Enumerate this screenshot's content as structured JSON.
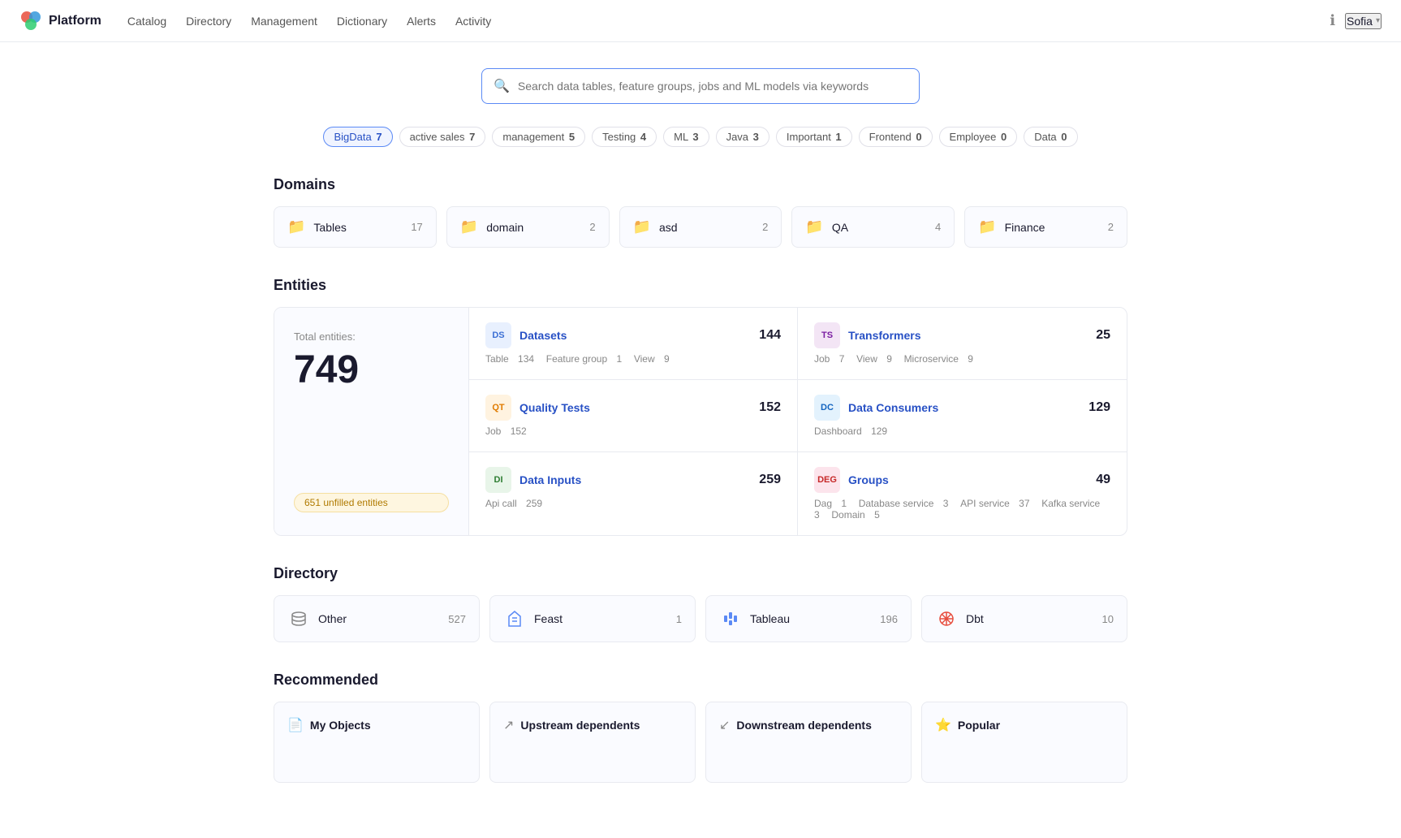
{
  "header": {
    "logo_text": "Platform",
    "nav": [
      {
        "label": "Catalog",
        "id": "catalog"
      },
      {
        "label": "Directory",
        "id": "directory"
      },
      {
        "label": "Management",
        "id": "management"
      },
      {
        "label": "Dictionary",
        "id": "dictionary"
      },
      {
        "label": "Alerts",
        "id": "alerts"
      },
      {
        "label": "Activity",
        "id": "activity"
      }
    ],
    "user": "Sofia"
  },
  "search": {
    "placeholder": "Search data tables, feature groups, jobs and ML models via keywords"
  },
  "tags": [
    {
      "label": "BigData",
      "count": "7",
      "active": true
    },
    {
      "label": "active sales",
      "count": "7",
      "active": false
    },
    {
      "label": "management",
      "count": "5",
      "active": false
    },
    {
      "label": "Testing",
      "count": "4",
      "active": false
    },
    {
      "label": "ML",
      "count": "3",
      "active": false
    },
    {
      "label": "Java",
      "count": "3",
      "active": false
    },
    {
      "label": "Important",
      "count": "1",
      "active": false
    },
    {
      "label": "Frontend",
      "count": "0",
      "active": false
    },
    {
      "label": "Employee",
      "count": "0",
      "active": false
    },
    {
      "label": "Data",
      "count": "0",
      "active": false
    }
  ],
  "domains": {
    "title": "Domains",
    "items": [
      {
        "name": "Tables",
        "count": "17"
      },
      {
        "name": "domain",
        "count": "2"
      },
      {
        "name": "asd",
        "count": "2"
      },
      {
        "name": "QA",
        "count": "4"
      },
      {
        "name": "Finance",
        "count": "2"
      }
    ]
  },
  "entities": {
    "title": "Entities",
    "total_label": "Total entities:",
    "total": "749",
    "unfilled": "651 unfilled entities",
    "items": [
      {
        "badge": "DS",
        "badge_class": "badge-ds",
        "name": "Datasets",
        "count": "144",
        "meta": [
          {
            "key": "Table",
            "val": "134"
          },
          {
            "key": "Feature group",
            "val": "1"
          },
          {
            "key": "View",
            "val": "9"
          }
        ]
      },
      {
        "badge": "TS",
        "badge_class": "badge-ts",
        "name": "Transformers",
        "count": "25",
        "meta": [
          {
            "key": "Job",
            "val": "7"
          },
          {
            "key": "View",
            "val": "9"
          },
          {
            "key": "Microservice",
            "val": "9"
          }
        ]
      },
      {
        "badge": "QT",
        "badge_class": "badge-qt",
        "name": "Quality Tests",
        "count": "152",
        "meta": [
          {
            "key": "Job",
            "val": "152"
          }
        ]
      },
      {
        "badge": "DC",
        "badge_class": "badge-dc",
        "name": "Data Consumers",
        "count": "129",
        "meta": [
          {
            "key": "Dashboard",
            "val": "129"
          }
        ]
      },
      {
        "badge": "DI",
        "badge_class": "badge-di",
        "name": "Data Inputs",
        "count": "259",
        "meta": [
          {
            "key": "Api call",
            "val": "259"
          }
        ]
      },
      {
        "badge": "DEG",
        "badge_class": "badge-deg",
        "name": "Groups",
        "count": "49",
        "meta": [
          {
            "key": "Dag",
            "val": "1"
          },
          {
            "key": "Database service",
            "val": "3"
          },
          {
            "key": "API service",
            "val": "37"
          },
          {
            "key": "Kafka service",
            "val": "3"
          },
          {
            "key": "Domain",
            "val": "5"
          }
        ]
      }
    ]
  },
  "directory": {
    "title": "Directory",
    "items": [
      {
        "name": "Other",
        "count": "527",
        "icon": "db"
      },
      {
        "name": "Feast",
        "count": "1",
        "icon": "feast"
      },
      {
        "name": "Tableau",
        "count": "196",
        "icon": "tableau"
      },
      {
        "name": "Dbt",
        "count": "10",
        "icon": "dbt"
      }
    ]
  },
  "recommended": {
    "title": "Recommended",
    "items": [
      {
        "label": "My Objects",
        "icon": "📄"
      },
      {
        "label": "Upstream dependents",
        "icon": "↗"
      },
      {
        "label": "Downstream dependents",
        "icon": "↙"
      },
      {
        "label": "Popular",
        "icon": "⭐"
      }
    ]
  }
}
